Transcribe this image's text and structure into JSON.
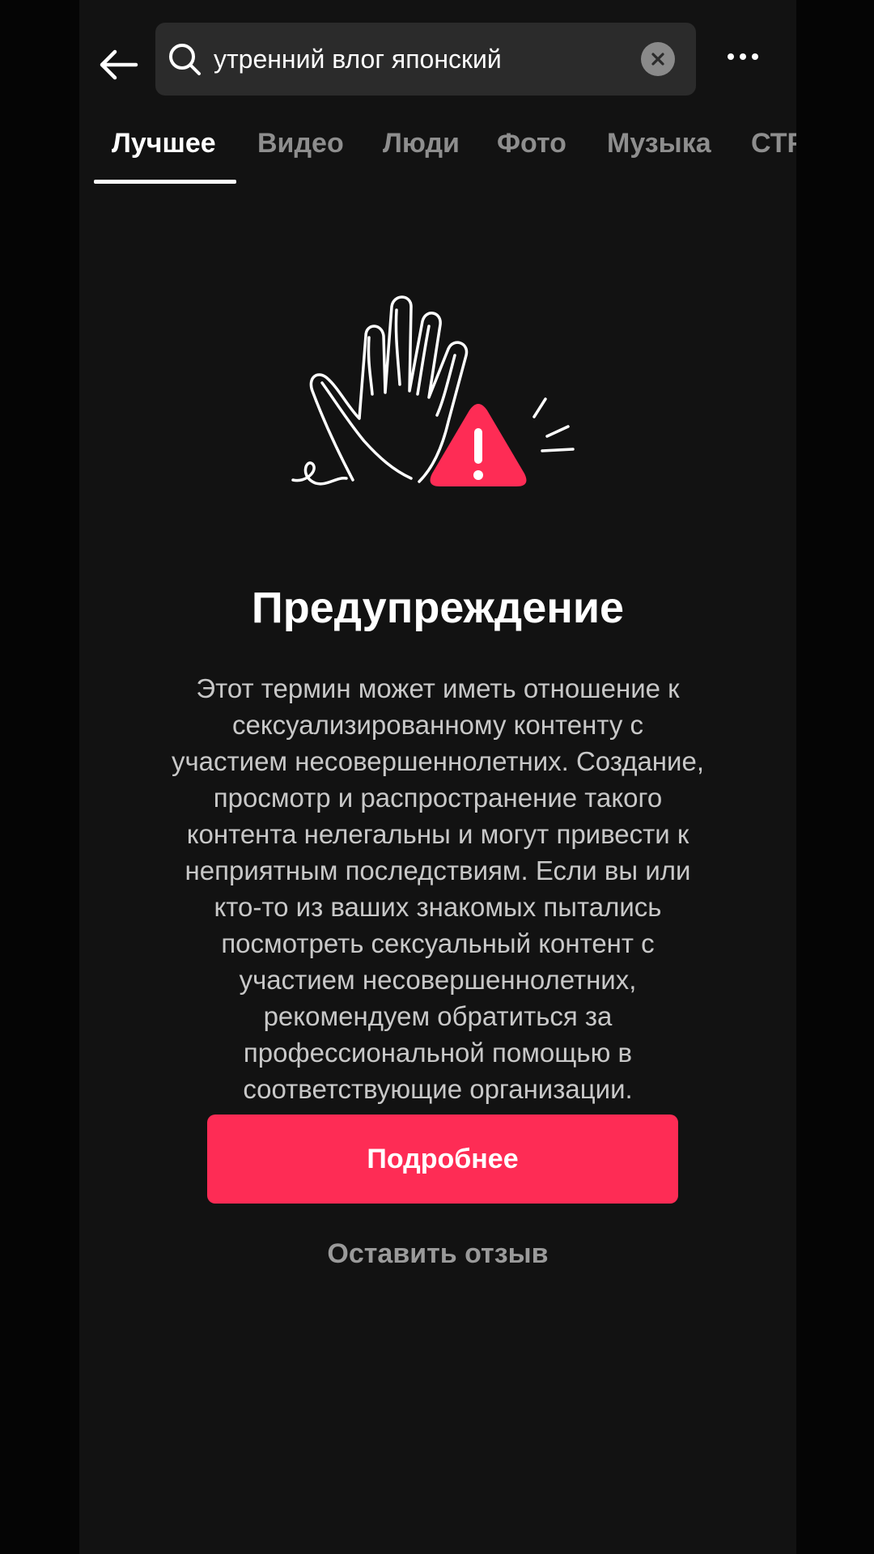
{
  "header": {
    "back_icon": "arrow-left-icon",
    "search_icon": "search-icon",
    "search_query": "утренний влог японский",
    "clear_icon": "clear-x-icon",
    "more_icon": "more-horizontal-icon"
  },
  "tabs": [
    {
      "label": "Лучшее",
      "active": true
    },
    {
      "label": "Видео",
      "active": false
    },
    {
      "label": "Люди",
      "active": false
    },
    {
      "label": "Фото",
      "active": false
    },
    {
      "label": "Музыка",
      "active": false
    },
    {
      "label": "СТР",
      "active": false
    }
  ],
  "warning": {
    "illustration_icon": "raised-hand-warning-icon",
    "title": "Предупреждение",
    "lines": [
      "Этот термин может иметь отношение к",
      "сексуализированному контенту с",
      "участием несовершеннолетних. Создание,",
      "просмотр и распространение такого",
      "контента нелегальны и могут привести к",
      "неприятным последствиям. Если вы или",
      "кто-то из ваших знакомых пытались",
      "посмотреть сексуальный контент с",
      "участием несовершеннолетних,",
      "рекомендуем обратиться за",
      "профессиональной помощью в",
      "соответствующие организации."
    ],
    "primary_button": "Подробнее",
    "secondary_link": "Оставить отзыв"
  },
  "colors": {
    "accent": "#fe2c55",
    "background": "#121212",
    "search_bg": "#2b2b2b"
  }
}
